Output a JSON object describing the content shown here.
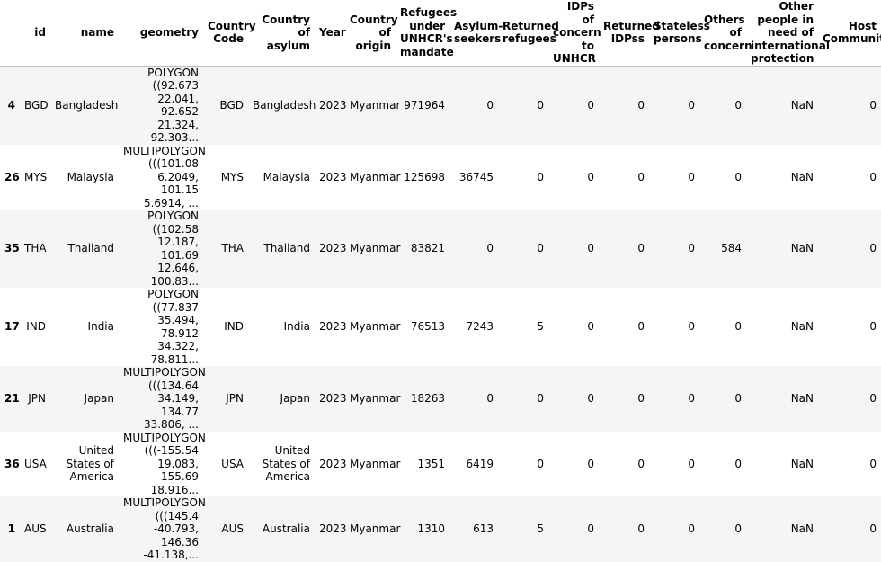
{
  "table": {
    "columns": [
      "",
      "id",
      "name",
      "geometry",
      "Country Code",
      "Country of asylum",
      "Year",
      "Country of origin",
      "Refugees under UNHCR's mandate",
      "Asylum-seekers",
      "Returned refugees",
      "IDPs of concern to UNHCR",
      "Returned IDPss",
      "Stateless persons",
      "Others of concern",
      "Other people in need of international protection",
      "Host Community"
    ],
    "rows": [
      [
        "4",
        "BGD",
        "Bangladesh",
        "POLYGON ((92.673 22.041, 92.652 21.324, 92.303...",
        "BGD",
        "Bangladesh",
        "2023",
        "Myanmar",
        "971964",
        "0",
        "0",
        "0",
        "0",
        "0",
        "0",
        "NaN",
        "0"
      ],
      [
        "26",
        "MYS",
        "Malaysia",
        "MULTIPOLYGON (((101.08 6.2049, 101.15 5.6914, ...",
        "MYS",
        "Malaysia",
        "2023",
        "Myanmar",
        "125698",
        "36745",
        "0",
        "0",
        "0",
        "0",
        "0",
        "NaN",
        "0"
      ],
      [
        "35",
        "THA",
        "Thailand",
        "POLYGON ((102.58 12.187, 101.69 12.646, 100.83...",
        "THA",
        "Thailand",
        "2023",
        "Myanmar",
        "83821",
        "0",
        "0",
        "0",
        "0",
        "0",
        "584",
        "NaN",
        "0"
      ],
      [
        "17",
        "IND",
        "India",
        "POLYGON ((77.837 35.494, 78.912 34.322, 78.811...",
        "IND",
        "India",
        "2023",
        "Myanmar",
        "76513",
        "7243",
        "5",
        "0",
        "0",
        "0",
        "0",
        "NaN",
        "0"
      ],
      [
        "21",
        "JPN",
        "Japan",
        "MULTIPOLYGON (((134.64 34.149, 134.77 33.806, ...",
        "JPN",
        "Japan",
        "2023",
        "Myanmar",
        "18263",
        "0",
        "0",
        "0",
        "0",
        "0",
        "0",
        "NaN",
        "0"
      ],
      [
        "36",
        "USA",
        "United States of America",
        "MULTIPOLYGON (((-155.54 19.083, -155.69 18.916...",
        "USA",
        "United States of America",
        "2023",
        "Myanmar",
        "1351",
        "6419",
        "0",
        "0",
        "0",
        "0",
        "0",
        "NaN",
        "0"
      ],
      [
        "1",
        "AUS",
        "Australia",
        "MULTIPOLYGON (((145.4 -40.793, 146.36 -41.138,...",
        "AUS",
        "Australia",
        "2023",
        "Myanmar",
        "1310",
        "613",
        "5",
        "0",
        "0",
        "0",
        "0",
        "NaN",
        "0"
      ]
    ]
  }
}
